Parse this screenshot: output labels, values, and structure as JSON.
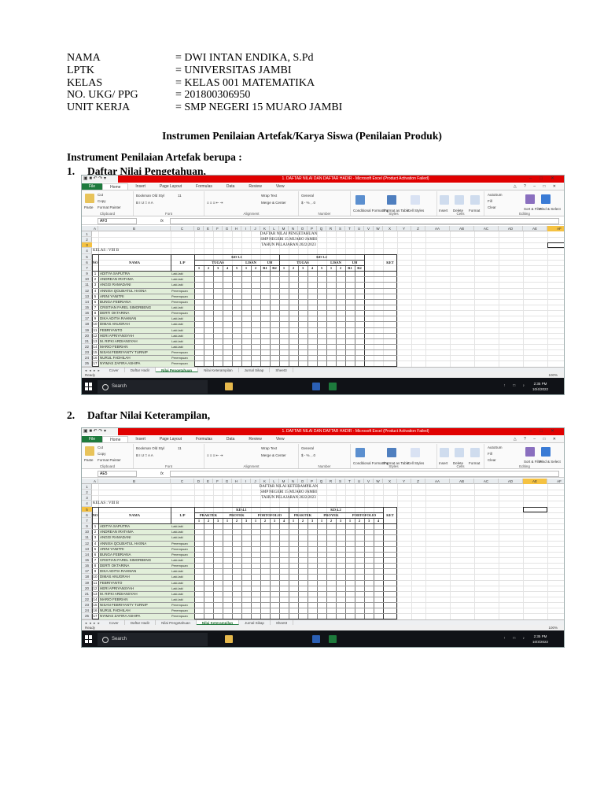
{
  "identity": [
    {
      "key": "NAMA",
      "value": "= DWI INTAN ENDIKA, S.Pd"
    },
    {
      "key": "LPTK",
      "value": "= UNIVERSITAS JAMBI"
    },
    {
      "key": "KELAS",
      "value": "= KELAS 001 MATEMATIKA"
    },
    {
      "key": "NO. UKG/ PPG",
      "value": "= 201800306950"
    },
    {
      "key": "UNIT KERJA",
      "value": "= SMP NEGERI 15 MUARO JAMBI"
    }
  ],
  "document_title": "Instrumen Penilaian Artefak/Karya Siswa (Penilaian Produk)",
  "intro": "Instrument Penilaian Artefak berupa :",
  "sections": [
    {
      "number": "1.",
      "title": "Daftar Nilai Pengetahuan,"
    },
    {
      "number": "2.",
      "title": "Daftar Nilai Keterampilan,"
    }
  ],
  "excel_common": {
    "title_bar": "1. DAFTAR NILAI DAN DAFTAR HADIR - Microsoft Excel (Product Activation Failed)",
    "ribbon_tabs": [
      "File",
      "Home",
      "Insert",
      "Page Layout",
      "Formulas",
      "Data",
      "Review",
      "View"
    ],
    "clipboard": {
      "cut": "Cut",
      "copy": "Copy",
      "paste": "Paste",
      "format_painter": "Format Painter",
      "label": "Clipboard"
    },
    "font": {
      "name": "Bookman Old Styl",
      "size": "11",
      "label": "Font"
    },
    "alignment": {
      "wrap": "Wrap Text",
      "merge": "Merge & Center",
      "label": "Alignment"
    },
    "number": {
      "format": "General",
      "label": "Number"
    },
    "styles": {
      "conditional": "Conditional Formatting",
      "format_table": "Format as Table",
      "cell_styles": "Cell Styles",
      "label": "Styles"
    },
    "cells": {
      "insert": "Insert",
      "delete": "Delete",
      "format": "Format",
      "label": "Cells"
    },
    "editing": {
      "autosum": "AutoSum",
      "fill": "Fill",
      "clear": "Clear",
      "sort": "Sort & Filter",
      "find": "Find & Select",
      "label": "Editing"
    },
    "columns": [
      "A",
      "B",
      "C",
      "D",
      "E",
      "F",
      "G",
      "H",
      "I",
      "J",
      "K",
      "L",
      "M",
      "N",
      "O",
      "P",
      "Q",
      "R",
      "S",
      "T",
      "U",
      "V",
      "W",
      "X",
      "Y",
      "Z",
      "AA",
      "AB",
      "AC",
      "AD",
      "AE",
      "AF"
    ],
    "sheet_tabs": [
      "Cover",
      "Daftar Hadir",
      "Nilai Pengetahuan",
      "Nilai Keterampilan",
      "Jurnal Sikap",
      "Sheet3"
    ],
    "status": "Ready",
    "zoom": "100%",
    "taskbar": {
      "search": "Search",
      "time": "2:35 PM",
      "date": "10/4/2022"
    },
    "school_lines": [
      "SMP NEGERI 15 MUARO JAMBI",
      "TAHUN PELAJARAN 2022/2023"
    ],
    "kelas": "KELAS : VIII B",
    "headers": {
      "no": "NO",
      "nama": "NAMA",
      "lp": "L/P",
      "ket": "KET"
    },
    "students": [
      {
        "no": "1",
        "name": "ADITYA SAPUTRA",
        "lp": "Laki-laki"
      },
      {
        "no": "2",
        "name": "ANDREAN IRATAMA",
        "lp": "Laki-laki"
      },
      {
        "no": "3",
        "name": "ANGGI RAMADANI",
        "lp": "Laki-laki"
      },
      {
        "no": "4",
        "name": "ANNISA QOLBIATUL HASNA",
        "lp": "Perempuan"
      },
      {
        "no": "5",
        "name": "ARINI YANITRI",
        "lp": "Perempuan"
      },
      {
        "no": "6",
        "name": "BUNGA FEBRIANA",
        "lp": "Perempuan"
      },
      {
        "no": "7",
        "name": "CRISTIAN FAREL SIMORBENG",
        "lp": "Laki-laki"
      },
      {
        "no": "8",
        "name": "DERTI OKTARINA",
        "lp": "Perempuan"
      },
      {
        "no": "9",
        "name": "DIKA ADITIA RAHMAN",
        "lp": "Laki-laki"
      },
      {
        "no": "10",
        "name": "DIMAS ANUGRAH",
        "lp": "Laki-laki"
      },
      {
        "no": "11",
        "name": "FEBRIYANTO",
        "lp": "Laki-laki"
      },
      {
        "no": "12",
        "name": "HERI APRIYANSYAH",
        "lp": "Laki-laki"
      },
      {
        "no": "13",
        "name": "M. RIFKI ARDIANSYAH",
        "lp": "Laki-laki"
      },
      {
        "no": "14",
        "name": "MARIO FEBRIAN",
        "lp": "Laki-laki"
      },
      {
        "no": "15",
        "name": "NISAN FEBRIYANTY TURNIP",
        "lp": "Perempuan"
      },
      {
        "no": "16",
        "name": "NURUL FADHILAH",
        "lp": "Perempuan"
      },
      {
        "no": "17",
        "name": "NYIMAS ZAFIRA ASHIPA",
        "lp": "Perempuan"
      },
      {
        "no": "18",
        "name": "PUTRI AMAYANI",
        "lp": "Perempuan"
      }
    ]
  },
  "excel1": {
    "namebox": "AF3",
    "active_sheet": "Nilai Pengetahuan",
    "sheet_title": "DAFTAR NILAI PENGETAHUAN",
    "kd_groups": [
      "KD 3.1",
      "KD 3.2"
    ],
    "sub_headers": [
      "TUGAS",
      "LISAN",
      "UH",
      "TUGAS",
      "LISAN",
      "UH"
    ],
    "numbers": [
      "1",
      "2",
      "3",
      "4",
      "5",
      "1",
      "2",
      "R1",
      "R2",
      "1",
      "2",
      "3",
      "4",
      "5",
      "1",
      "2",
      "R1",
      "R2"
    ]
  },
  "excel2": {
    "namebox": "AE5",
    "active_sheet": "Nilai Keterampilan",
    "sheet_title": "DAFTAR NILAI KETERAMPILAN",
    "kd_groups": [
      "KD 4.1",
      "KD 4.2"
    ],
    "sub_headers": [
      "PRAKTEK",
      "PROYEK",
      "PORTOFOLIO",
      "PRAKTEK",
      "PROYEK",
      "PORTOFOLIO"
    ],
    "numbers": [
      "1",
      "2",
      "3",
      "1",
      "2",
      "3",
      "1",
      "2",
      "3",
      "4",
      "1",
      "2",
      "3",
      "1",
      "2",
      "3",
      "1",
      "2",
      "3",
      "4"
    ]
  }
}
